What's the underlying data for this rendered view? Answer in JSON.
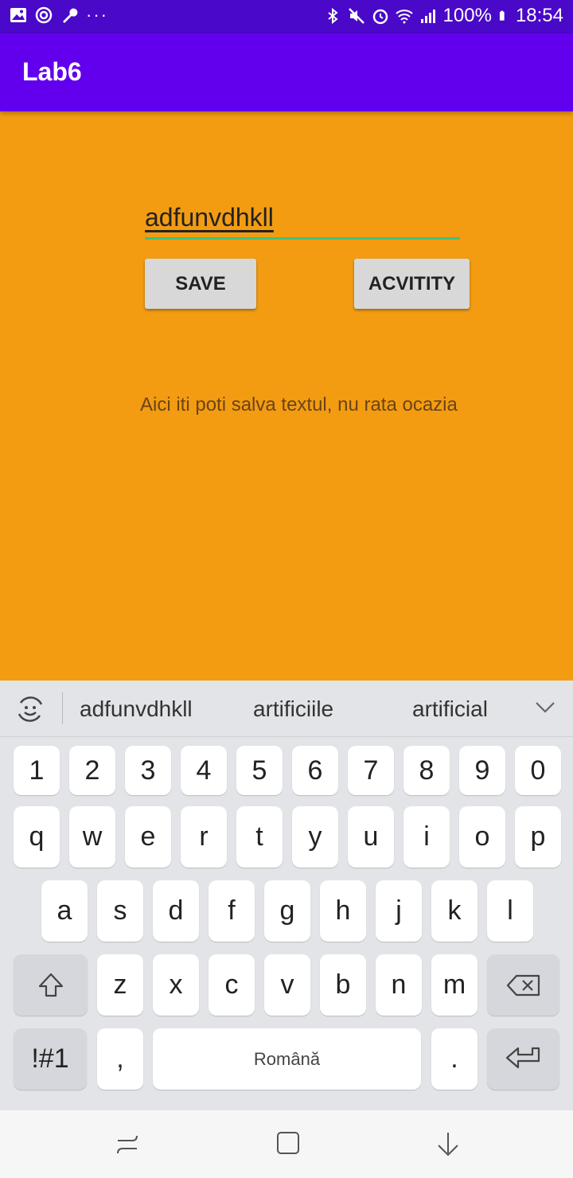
{
  "status_bar": {
    "battery": "100%",
    "time": "18:54",
    "left_icons": [
      "gallery-icon",
      "sync-icon",
      "wrench-icon",
      "more-dots-icon"
    ],
    "right_icons": [
      "bluetooth-icon",
      "mute-icon",
      "alarm-icon",
      "wifi-icon",
      "signal-icon",
      "battery-icon"
    ]
  },
  "app_bar": {
    "title": "Lab6",
    "color": "#6200EE"
  },
  "main": {
    "background": "#F39C12",
    "input_value": "adfunvdhkll",
    "save_label": "SAVE",
    "activity_label": "ACVITITY",
    "info_text": "Aici iti poti salva textul, nu rata ocazia"
  },
  "keyboard": {
    "suggestions": [
      "adfunvdhkll",
      "artificiile",
      "artificial"
    ],
    "row_numbers": [
      "1",
      "2",
      "3",
      "4",
      "5",
      "6",
      "7",
      "8",
      "9",
      "0"
    ],
    "row1": [
      "q",
      "w",
      "e",
      "r",
      "t",
      "y",
      "u",
      "i",
      "o",
      "p"
    ],
    "row2": [
      "a",
      "s",
      "d",
      "f",
      "g",
      "h",
      "j",
      "k",
      "l"
    ],
    "row3": [
      "z",
      "x",
      "c",
      "v",
      "b",
      "n",
      "m"
    ],
    "symbols_label": "!#1",
    "comma_label": ",",
    "space_label": "Română",
    "period_label": "."
  },
  "navbar": {
    "icons": [
      "recents-icon",
      "home-icon",
      "back-icon"
    ]
  }
}
